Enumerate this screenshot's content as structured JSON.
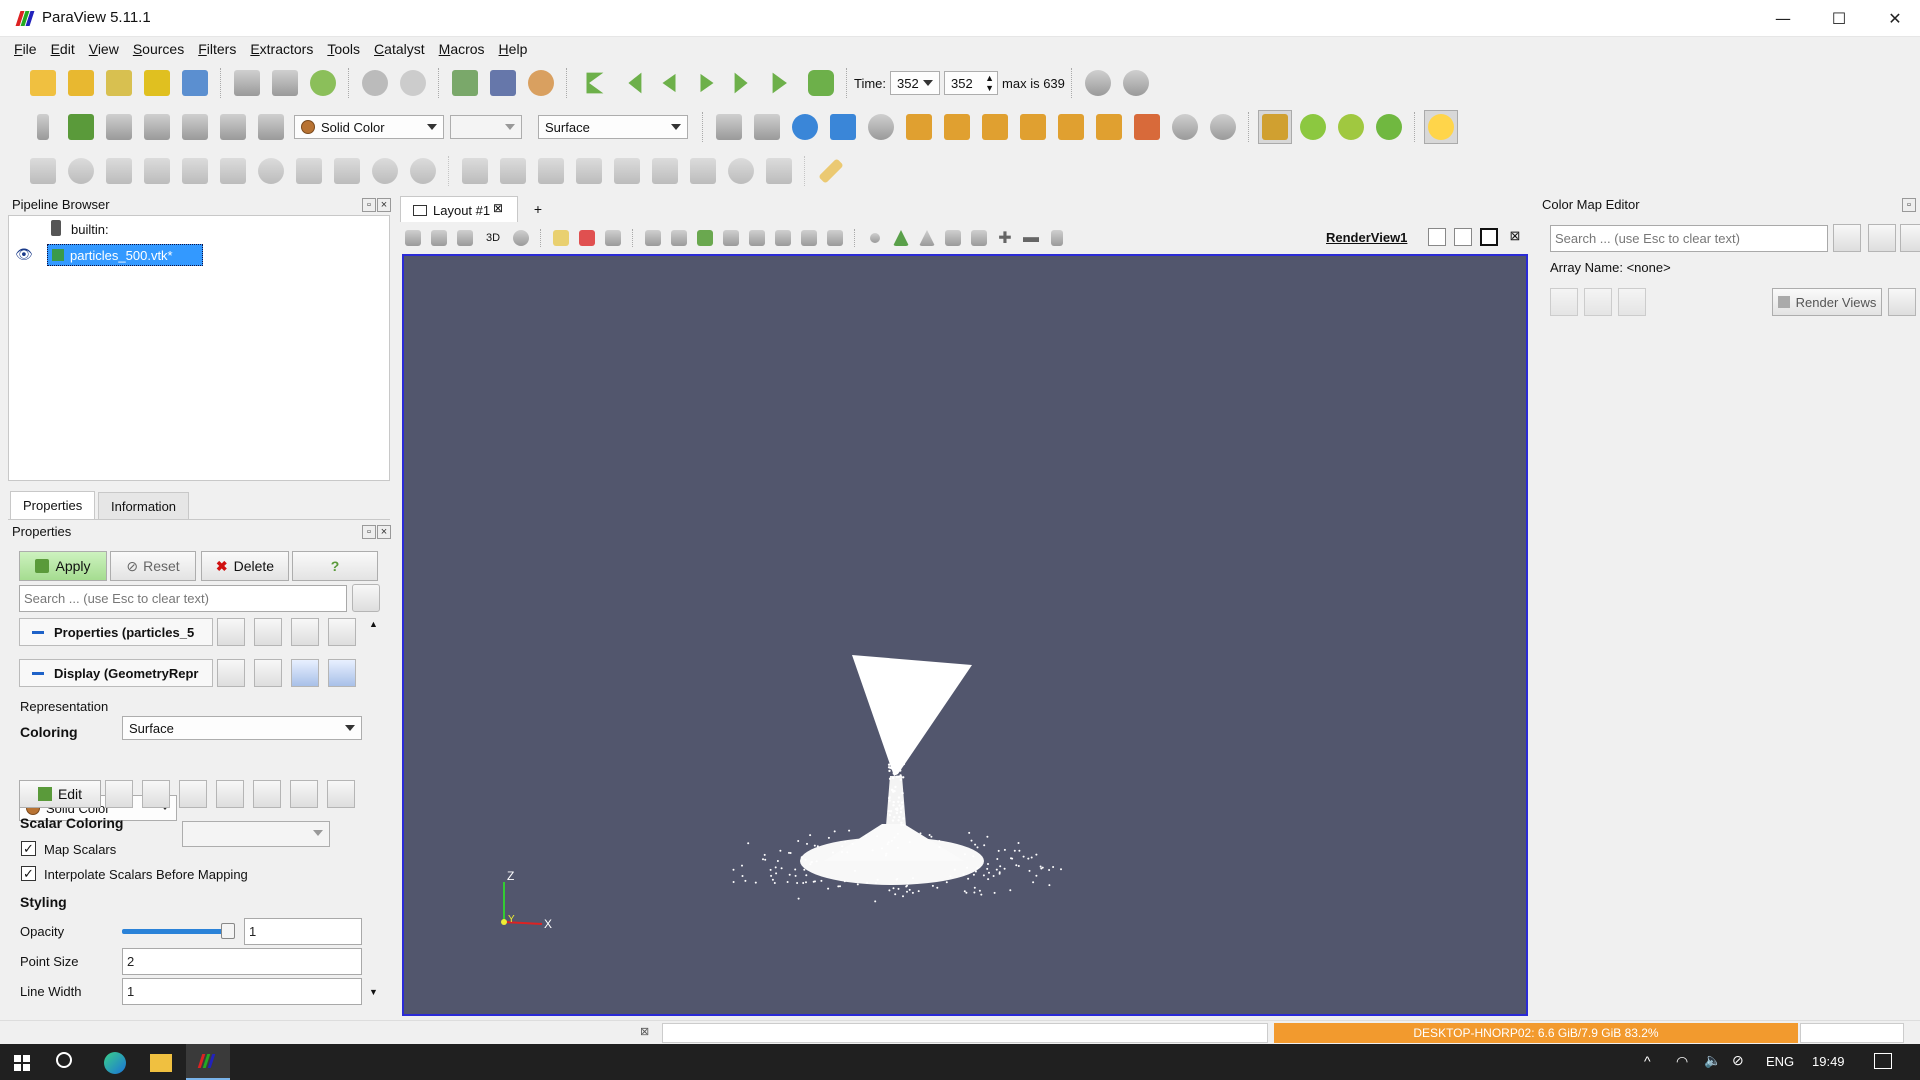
{
  "window": {
    "title": "ParaView 5.11.1",
    "minimize": "—",
    "maximize": "☐",
    "close": "✕"
  },
  "menu": [
    {
      "label": "File",
      "ul": "F",
      "rest": "ile"
    },
    {
      "label": "Edit",
      "ul": "E",
      "rest": "dit"
    },
    {
      "label": "View",
      "ul": "V",
      "rest": "iew"
    },
    {
      "label": "Sources",
      "ul": "S",
      "rest": "ources"
    },
    {
      "label": "Filters",
      "ul": "F",
      "rest": "ilters"
    },
    {
      "label": "Extractors",
      "ul": "E",
      "rest": "xtractors"
    },
    {
      "label": "Tools",
      "ul": "T",
      "rest": "ools"
    },
    {
      "label": "Catalyst",
      "ul": "C",
      "rest": "atalyst"
    },
    {
      "label": "Macros",
      "ul": "M",
      "rest": "acros"
    },
    {
      "label": "Help",
      "ul": "H",
      "rest": "elp"
    }
  ],
  "time": {
    "label": "Time:",
    "value": "352",
    "step": "352",
    "max": "max is 639"
  },
  "toolbar2": {
    "color_mode": "Solid Color",
    "representation": "Surface"
  },
  "pipeline": {
    "title": "Pipeline Browser",
    "root": "builtin:",
    "items": [
      {
        "label": "particles_500.vtk*",
        "selected": true
      }
    ]
  },
  "tabs": {
    "properties": "Properties",
    "information": "Information"
  },
  "properties": {
    "title": "Properties",
    "apply": "Apply",
    "reset": "Reset",
    "delete": "Delete",
    "help": "?",
    "search_placeholder": "Search ... (use Esc to clear text)",
    "group1": "Properties (particles_5",
    "group2": "Display (GeometryRepr",
    "representation_label": "Representation",
    "representation_value": "Surface",
    "coloring_section": "Coloring",
    "coloring_value": "Solid Color",
    "edit": "Edit",
    "scalar_section": "Scalar Coloring",
    "map_scalars": "Map Scalars",
    "interpolate": "Interpolate Scalars Before Mapping",
    "styling_section": "Styling",
    "opacity_label": "Opacity",
    "opacity_value": "1",
    "point_size_label": "Point Size",
    "point_size_value": "2",
    "line_width_label": "Line Width",
    "line_width_value": "1"
  },
  "layout": {
    "tab": "Layout #1",
    "add": "+",
    "view_name": "RenderView1",
    "mode_3d": "3D"
  },
  "axes": {
    "z": "Z",
    "x": "X",
    "y": "Y"
  },
  "colormap": {
    "title": "Color Map Editor",
    "search_placeholder": "Search ... (use Esc to clear text)",
    "array_name": "Array Name: <none>",
    "render_views": "Render Views"
  },
  "status": {
    "memory": "DESKTOP-HNORP02: 6.6 GiB/7.9 GiB 83.2%"
  },
  "taskbar": {
    "lang": "ENG",
    "clock": "19:49"
  },
  "colors": {
    "render_bg": "#52566d",
    "selection": "#3399ff",
    "memory_bar": "#f29a2e",
    "apply_green": "#b6e8a6"
  }
}
